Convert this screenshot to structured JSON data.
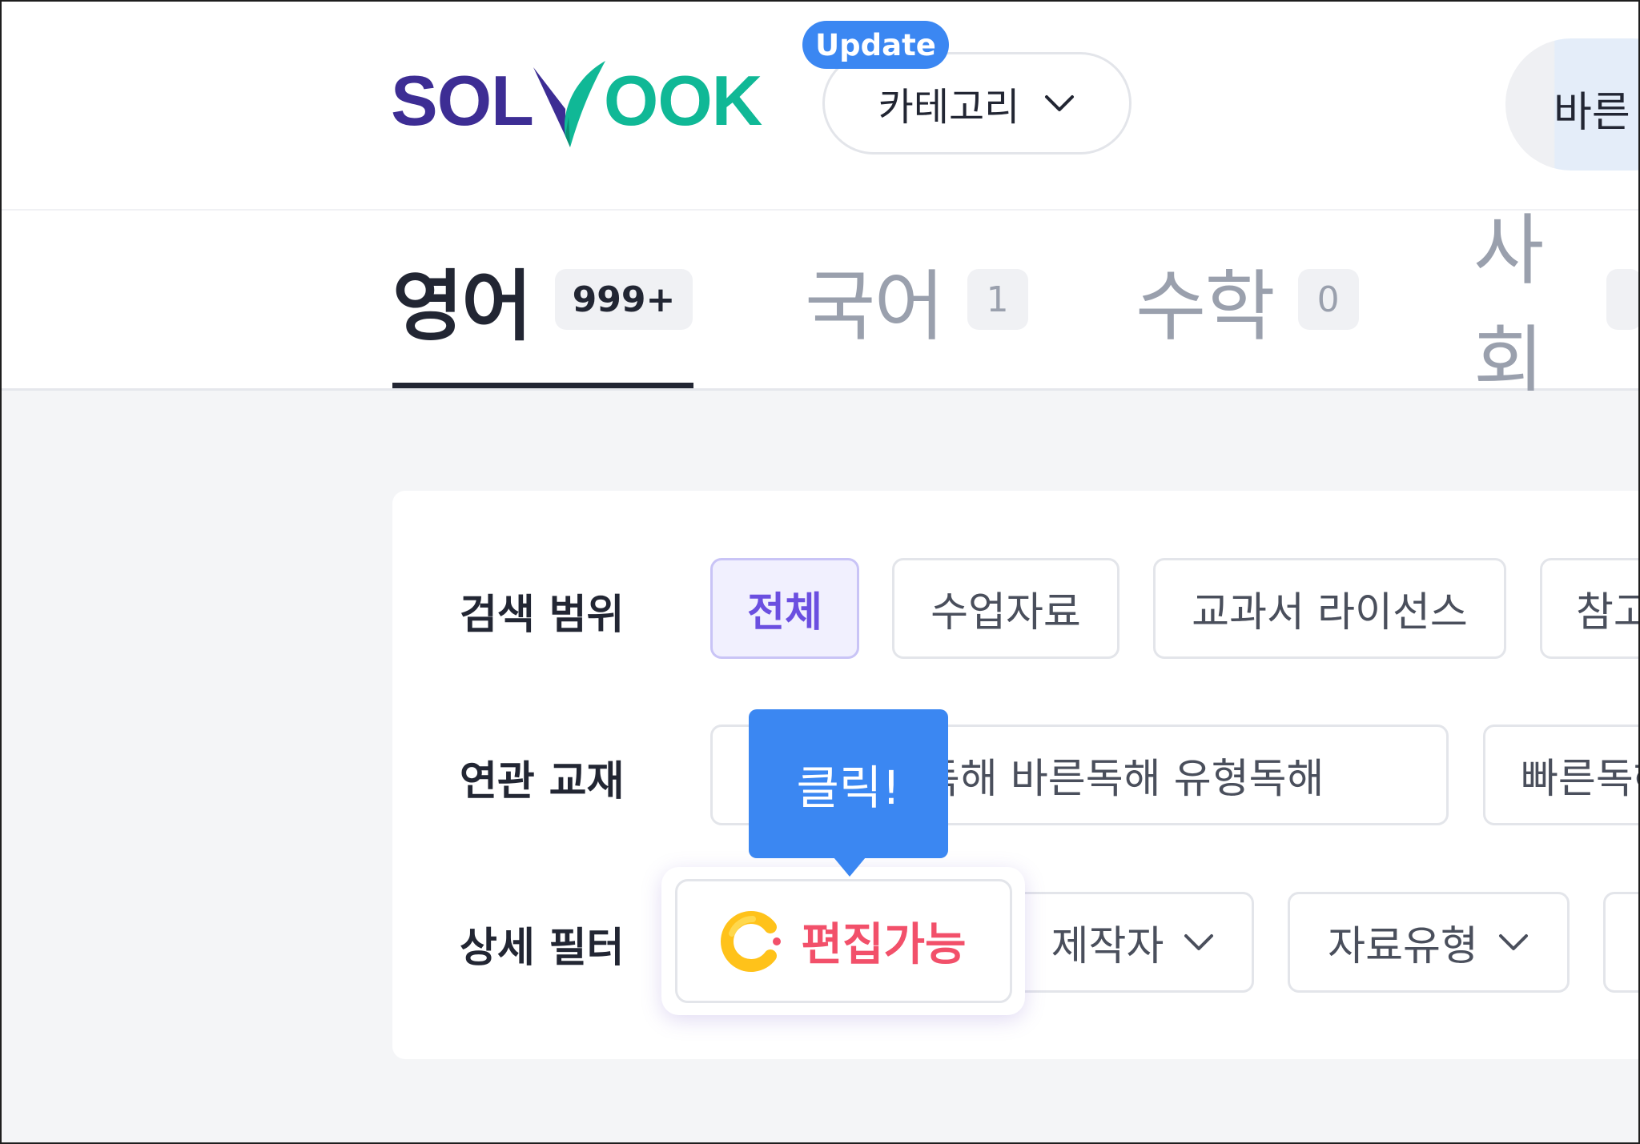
{
  "header": {
    "logo": {
      "part1": "SOL",
      "part2": "OOK"
    },
    "update_badge": "Update",
    "category_button": {
      "label": "카테고리"
    },
    "right_button_partial": "바른"
  },
  "tabs": [
    {
      "label": "영어",
      "count": "999+",
      "active": true
    },
    {
      "label": "국어",
      "count": "1",
      "active": false
    },
    {
      "label": "수학",
      "count": "0",
      "active": false
    },
    {
      "label": "사회",
      "count": "",
      "active": false
    }
  ],
  "filters": {
    "search_scope": {
      "label": "검색 범위",
      "options": [
        "전체",
        "수업자료",
        "교과서 라이선스",
        "참고"
      ],
      "selected": "전체"
    },
    "related_textbook": {
      "label": "연관 교재",
      "options": [
        "",
        "바른독해 바른독해 유형독해",
        "빠른독해"
      ]
    },
    "detail_filter": {
      "label": "상세 필터",
      "editable": "편집가능",
      "dropdowns": [
        "제작자",
        "자료유형"
      ]
    }
  },
  "tooltip": {
    "text": "클릭!"
  },
  "colors": {
    "brand_purple": "#3d2d94",
    "brand_green": "#10b896",
    "accent_blue": "#3b87f2",
    "selected_text": "#6b4fe0",
    "editable_red": "#f2506a"
  },
  "icons": [
    "chevron-down-icon",
    "editable-c-icon",
    "logo-leaf-icon"
  ]
}
